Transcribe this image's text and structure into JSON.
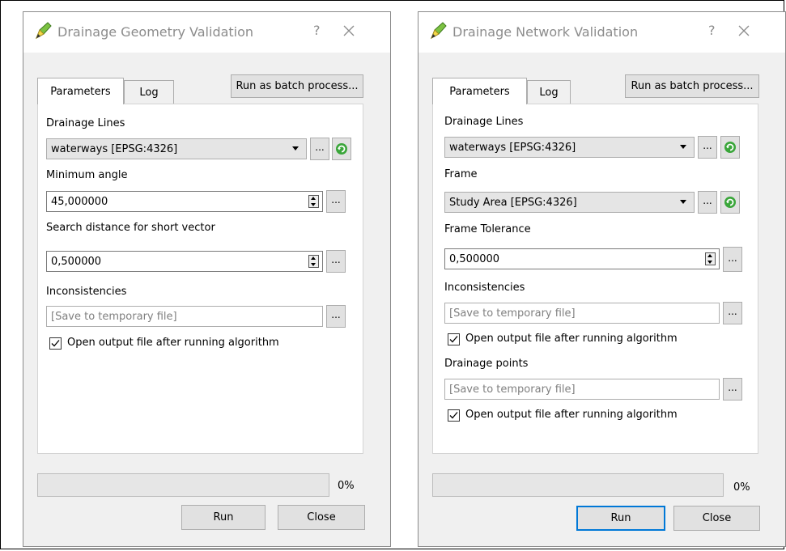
{
  "dialogs": [
    {
      "title": "Drainage Geometry Validation",
      "help": "?",
      "tabs": [
        "Parameters",
        "Log"
      ],
      "batch_label": "Run as batch process...",
      "fields": {
        "drainage_lines_label": "Drainage Lines",
        "drainage_lines_value": "waterways [EPSG:4326]",
        "min_angle_label": "Minimum angle",
        "min_angle_value": "45,000000",
        "search_dist_label": "Search distance for short vector",
        "search_dist_value": "0,500000",
        "inconsistencies_label": "Inconsistencies",
        "inconsistencies_placeholder": "[Save to temporary file]",
        "open_output_label": "Open output file after running algorithm",
        "open_output_checked": true
      },
      "browse_label": "...",
      "progress_percent": 0,
      "progress_text": "0%",
      "run_label": "Run",
      "close_label": "Close"
    },
    {
      "title": "Drainage Network Validation",
      "help": "?",
      "tabs": [
        "Parameters",
        "Log"
      ],
      "batch_label": "Run as batch process...",
      "fields": {
        "drainage_lines_label": "Drainage Lines",
        "drainage_lines_value": "waterways [EPSG:4326]",
        "frame_label": "Frame",
        "frame_value": "Study Area [EPSG:4326]",
        "frame_tolerance_label": "Frame Tolerance",
        "frame_tolerance_value": "0,500000",
        "inconsistencies_label": "Inconsistencies",
        "inconsistencies_placeholder": "[Save to temporary file]",
        "open_output_label": "Open output file after running algorithm",
        "open_output_checked": true,
        "drainage_points_label": "Drainage points",
        "drainage_points_placeholder": "[Save to temporary file]",
        "open_output2_label": "Open output file after running algorithm",
        "open_output2_checked": true
      },
      "browse_label": "...",
      "progress_percent": 0,
      "progress_text": "0%",
      "run_label": "Run",
      "close_label": "Close"
    }
  ],
  "icons": {
    "app": "qgis-pencil-icon",
    "refresh": "refresh-icon",
    "close": "close-icon",
    "check": "checkmark-icon"
  },
  "colors": {
    "focus_border": "#0078d7",
    "refresh_green": "#3aa63a",
    "placeholder_text": "#808080"
  }
}
